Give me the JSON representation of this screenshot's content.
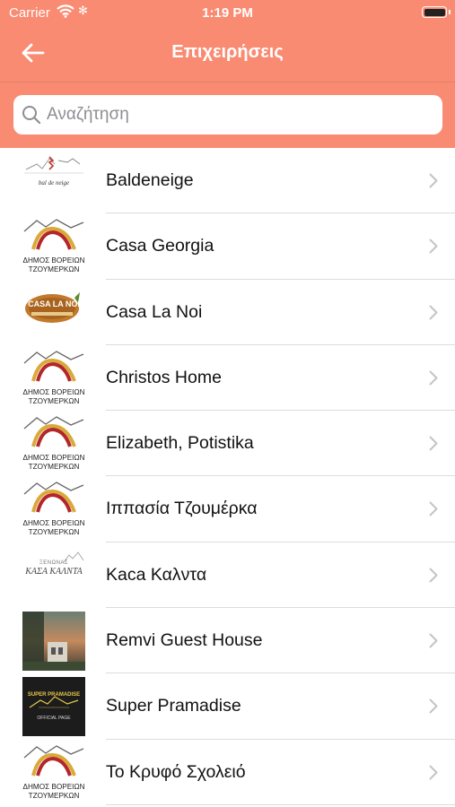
{
  "status_bar": {
    "carrier": "Carrier",
    "time": "1:19 PM"
  },
  "nav": {
    "title": "Επιχειρήσεις",
    "back_icon": "arrow-left-icon"
  },
  "search": {
    "placeholder": "Αναζήτηση",
    "value": "",
    "icon": "search-icon"
  },
  "colors": {
    "header": "#f98b72",
    "divider": "#dcdcdc",
    "chevron": "#c4c4c7"
  },
  "logo_texts": {
    "municipality_line1": "ΔΗΜΟΣ ΒΟΡΕΙΩΝ",
    "municipality_line2": "ΤΖΟΥΜΕΡΚΩΝ",
    "baldeneige": "bal de neige",
    "casa_la_noi": "CASA LA NOI",
    "kaca_top": "ΞΕΝΩΝΑΣ",
    "kaca_main": "ΚΑΣΑ ΚΑΛΝΤΑ",
    "super_pramadise": "SUPER PRAMADISE",
    "official_page": "OFFICIAL PAGE"
  },
  "businesses": [
    {
      "name": "Baldeneige",
      "logo": "baldeneige"
    },
    {
      "name": "Casa Georgia",
      "logo": "municipality"
    },
    {
      "name": "Casa La Noi",
      "logo": "casa-la-noi"
    },
    {
      "name": "Christos Home",
      "logo": "municipality"
    },
    {
      "name": "Elizabeth, Potistika",
      "logo": "municipality"
    },
    {
      "name": "Ιππασία Τζουμέρκα",
      "logo": "municipality"
    },
    {
      "name": "Kaca Καλντα",
      "logo": "kaca-kalnta"
    },
    {
      "name": "Remvi Guest House",
      "logo": "photo"
    },
    {
      "name": "Super Pramadise",
      "logo": "super-pramadise"
    },
    {
      "name": "Το Κρυφό Σχολειό",
      "logo": "municipality"
    }
  ]
}
